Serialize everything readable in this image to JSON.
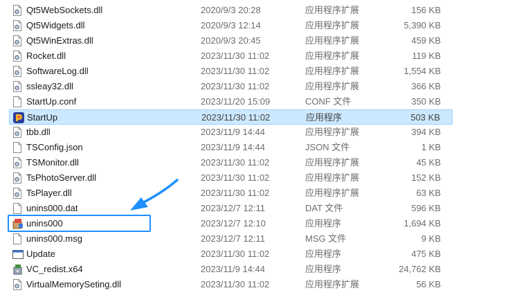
{
  "files": [
    {
      "name": "Qt5WebSockets.dll",
      "date": "2020/9/3 20:28",
      "type": "应用程序扩展",
      "size": "156 KB",
      "icon": "dll-file-icon"
    },
    {
      "name": "Qt5Widgets.dll",
      "date": "2020/9/3 12:14",
      "type": "应用程序扩展",
      "size": "5,390 KB",
      "icon": "dll-file-icon"
    },
    {
      "name": "Qt5WinExtras.dll",
      "date": "2020/9/3 20:45",
      "type": "应用程序扩展",
      "size": "459 KB",
      "icon": "dll-file-icon"
    },
    {
      "name": "Rocket.dll",
      "date": "2023/11/30 11:02",
      "type": "应用程序扩展",
      "size": "119 KB",
      "icon": "dll-file-icon"
    },
    {
      "name": "SoftwareLog.dll",
      "date": "2023/11/30 11:02",
      "type": "应用程序扩展",
      "size": "1,554 KB",
      "icon": "dll-file-icon"
    },
    {
      "name": "ssleay32.dll",
      "date": "2023/11/30 11:02",
      "type": "应用程序扩展",
      "size": "366 KB",
      "icon": "dll-file-icon"
    },
    {
      "name": "StartUp.conf",
      "date": "2023/11/20 15:09",
      "type": "CONF 文件",
      "size": "350 KB",
      "icon": "blank-file-icon"
    },
    {
      "name": "StartUp",
      "date": "2023/11/30 11:02",
      "type": "应用程序",
      "size": "503 KB",
      "icon": "app-logo-icon"
    },
    {
      "name": "tbb.dll",
      "date": "2023/11/9 14:44",
      "type": "应用程序扩展",
      "size": "394 KB",
      "icon": "dll-file-icon"
    },
    {
      "name": "TSConfig.json",
      "date": "2023/11/9 14:44",
      "type": "JSON 文件",
      "size": "1 KB",
      "icon": "blank-file-icon"
    },
    {
      "name": "TSMonitor.dll",
      "date": "2023/11/30 11:02",
      "type": "应用程序扩展",
      "size": "45 KB",
      "icon": "dll-file-icon"
    },
    {
      "name": "TsPhotoServer.dll",
      "date": "2023/11/30 11:02",
      "type": "应用程序扩展",
      "size": "152 KB",
      "icon": "dll-file-icon"
    },
    {
      "name": "TsPlayer.dll",
      "date": "2023/11/30 11:02",
      "type": "应用程序扩展",
      "size": "63 KB",
      "icon": "dll-file-icon"
    },
    {
      "name": "unins000.dat",
      "date": "2023/12/7 12:11",
      "type": "DAT 文件",
      "size": "596 KB",
      "icon": "blank-file-icon"
    },
    {
      "name": "unins000",
      "date": "2023/12/7 12:10",
      "type": "应用程序",
      "size": "1,694 KB",
      "icon": "uninstaller-icon"
    },
    {
      "name": "unins000.msg",
      "date": "2023/12/7 12:11",
      "type": "MSG 文件",
      "size": "9 KB",
      "icon": "blank-file-icon"
    },
    {
      "name": "Update",
      "date": "2023/11/30 11:02",
      "type": "应用程序",
      "size": "475 KB",
      "icon": "exe-window-icon"
    },
    {
      "name": "VC_redist.x64",
      "date": "2023/11/9 14:44",
      "type": "应用程序",
      "size": "24,762 KB",
      "icon": "installer-icon"
    },
    {
      "name": "VirtualMemorySeting.dll",
      "date": "2023/11/30 11:02",
      "type": "应用程序扩展",
      "size": "56 KB",
      "icon": "dll-file-icon"
    }
  ],
  "selected_name": "StartUp",
  "colors": {
    "selection_bg": "#cce8ff",
    "selection_border": "#99d1ff",
    "annotation": "#1e90ff"
  }
}
